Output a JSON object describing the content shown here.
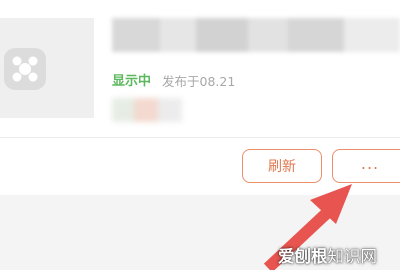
{
  "item": {
    "status": "显示中",
    "publish_info": "发布于08.21"
  },
  "actions": {
    "refresh_label": "刷新",
    "more_label": "..."
  },
  "watermark": {
    "brand": "爱刨根",
    "site": "知识网"
  },
  "colors": {
    "status_green": "#5cb85c",
    "button_orange": "#e07850",
    "arrow_red": "#e8544f"
  },
  "icons": {
    "thumbnail": "app-icon"
  }
}
